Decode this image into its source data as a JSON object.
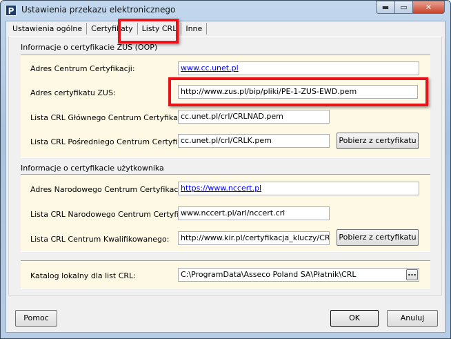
{
  "window": {
    "title": "Ustawienia przekazu elektronicznego",
    "icon_letter": "P"
  },
  "tabs": [
    {
      "label": "Ustawienia ogólne"
    },
    {
      "label": "Certyfikaty"
    },
    {
      "label": "Listy CRL"
    },
    {
      "label": "Inne"
    }
  ],
  "zus": {
    "group_label": "Informacje o certyfikacie ZUS (OOP)",
    "rows": [
      {
        "label": "Adres Centrum Certyfikacji:",
        "value": "www.cc.unet.pl"
      },
      {
        "label": "Adres certyfikatu ZUS:",
        "value": "http://www.zus.pl/bip/pliki/PE-1-ZUS-EWD.pem"
      },
      {
        "label": "Lista CRL Głównego Centrum Certyfikacji:",
        "value": "cc.unet.pl/crl/CRLNAD.pem"
      },
      {
        "label": "Lista CRL Pośredniego Centrum Certyfikacji:",
        "value": "cc.unet.pl/crl/CRLK.pem"
      }
    ],
    "button": "Pobierz z certyfikatu"
  },
  "user": {
    "group_label": "Informacje o certyfikacie użytkownika",
    "rows": [
      {
        "label": "Adres Narodowego Centrum Certyfikacji:",
        "value": "https://www.nccert.pl"
      },
      {
        "label": "Lista CRL Narodowego Centrum Certyfikacji:",
        "value": "www.nccert.pl/arl/nccert.crl"
      },
      {
        "label": "Lista CRL Centrum Kwalifikowanego:",
        "value": "http://www.kir.pl/certyfikacja_kluczy/CRL_O"
      }
    ],
    "button": "Pobierz z certyfikatu"
  },
  "local": {
    "label": "Katalog lokalny dla list CRL:",
    "value": "C:\\ProgramData\\Asseco Poland SA\\Płatnik\\CRL",
    "browse": "..."
  },
  "footer": {
    "help": "Pomoc",
    "ok": "OK",
    "cancel": "Anuluj"
  }
}
